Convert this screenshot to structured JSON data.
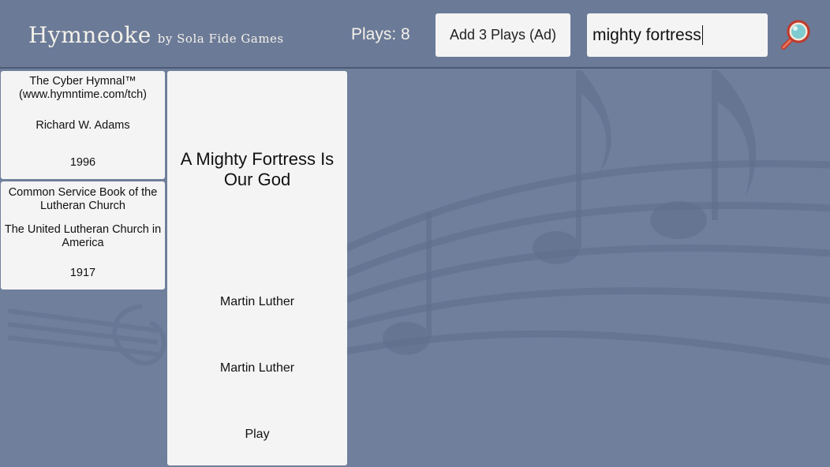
{
  "header": {
    "app_title": "Hymneoke",
    "app_subtitle": "by Sola Fide Games",
    "plays_text": "Plays: 8",
    "ad_button_label": "Add 3 Plays (Ad)",
    "search_value": "mighty fortress",
    "search_icon": "magnifier-icon"
  },
  "results": [
    {
      "source": "The Cyber Hymnal™ (www.hymntime.com/tch)",
      "author": "Richard W. Adams",
      "year": "1996"
    },
    {
      "source": "Common Service Book of the Lutheran Church",
      "author": "The United Lutheran Church in America",
      "year": "1917"
    }
  ],
  "detail": {
    "title": "A Mighty Fortress Is Our God",
    "lyricist": "Martin Luther",
    "composer": "Martin Luther",
    "play_label": "Play"
  },
  "colors": {
    "background": "#6f7f9c",
    "panel": "#f4f4f4",
    "header_text": "#f4f2ea"
  }
}
